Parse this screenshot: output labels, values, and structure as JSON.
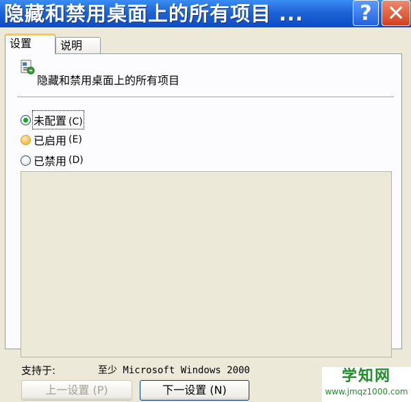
{
  "window": {
    "title": "隐藏和禁用桌面上的所有项目 ...",
    "help_glyph": "?",
    "close_glyph": "✕"
  },
  "tabs": [
    {
      "label": "设置",
      "active": true
    },
    {
      "label": "说明",
      "active": false
    }
  ],
  "policy": {
    "icon": "policy-setting-icon",
    "title": "隐藏和禁用桌面上的所有项目"
  },
  "options": [
    {
      "label": "未配置",
      "key": "(C)",
      "selected": true
    },
    {
      "label": "已启用",
      "key": "(E)",
      "selected": false
    },
    {
      "label": "已禁用",
      "key": "(D)",
      "selected": false
    }
  ],
  "support": {
    "label": "支持于:",
    "value": "至少 Microsoft Windows 2000"
  },
  "buttons": {
    "prev_label": "上一设置 (P)",
    "next_label": "下一设置 (N)"
  },
  "watermark": {
    "main": "学知网",
    "sub": "www.jmqz1000.com"
  },
  "colors": {
    "titlebar": "#0A4CC8",
    "dialog_bg": "#ECE9D8",
    "tab_active_accent": "#FFC83C",
    "radio_checked": "#21A121",
    "watermark": "#1F8F2A"
  }
}
